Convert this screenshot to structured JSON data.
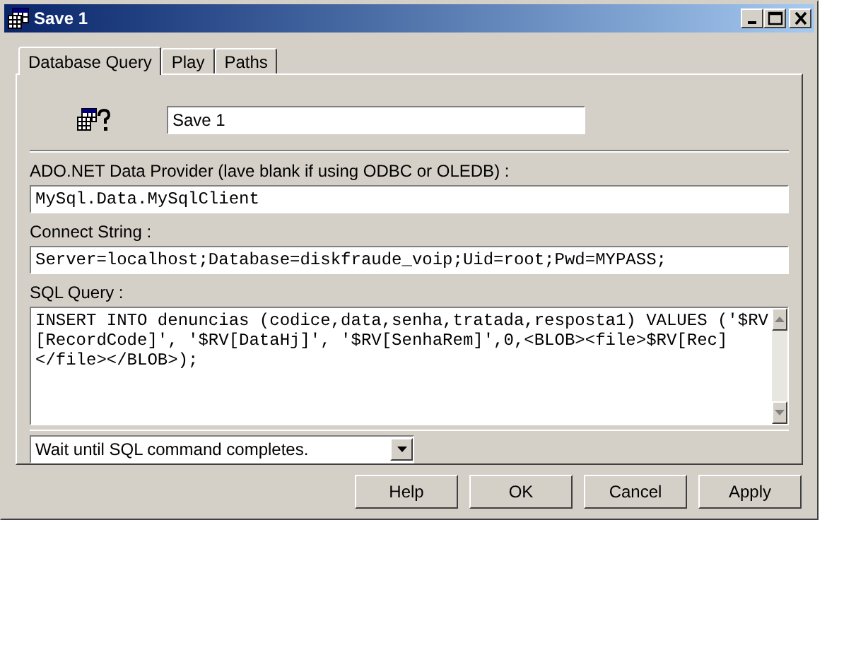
{
  "window": {
    "title": "Save 1"
  },
  "tabs": [
    {
      "label": "Database Query",
      "selected": true
    },
    {
      "label": "Play",
      "selected": false
    },
    {
      "label": "Paths",
      "selected": false
    }
  ],
  "name_field": {
    "value": "Save 1"
  },
  "provider": {
    "label": "ADO.NET Data Provider (lave blank if using ODBC or OLEDB) :",
    "value": "MySql.Data.MySqlClient"
  },
  "connect": {
    "label": "Connect String :",
    "value": "Server=localhost;Database=diskfraude_voip;Uid=root;Pwd=MYPASS;"
  },
  "sql": {
    "label": "SQL Query :",
    "lines": [
      "INSERT INTO denuncias (codice,data,senha,tratada,resposta1) VALUES ('$RV",
      "[RecordCode]', '$RV[DataHj]', '$RV[SenhaRem]',0,<BLOB><file>$RV[Rec]",
      "</file></BLOB>);"
    ]
  },
  "wait_mode": {
    "value": "Wait until SQL command completes."
  },
  "buttons": [
    "Help",
    "OK",
    "Cancel",
    "Apply"
  ]
}
